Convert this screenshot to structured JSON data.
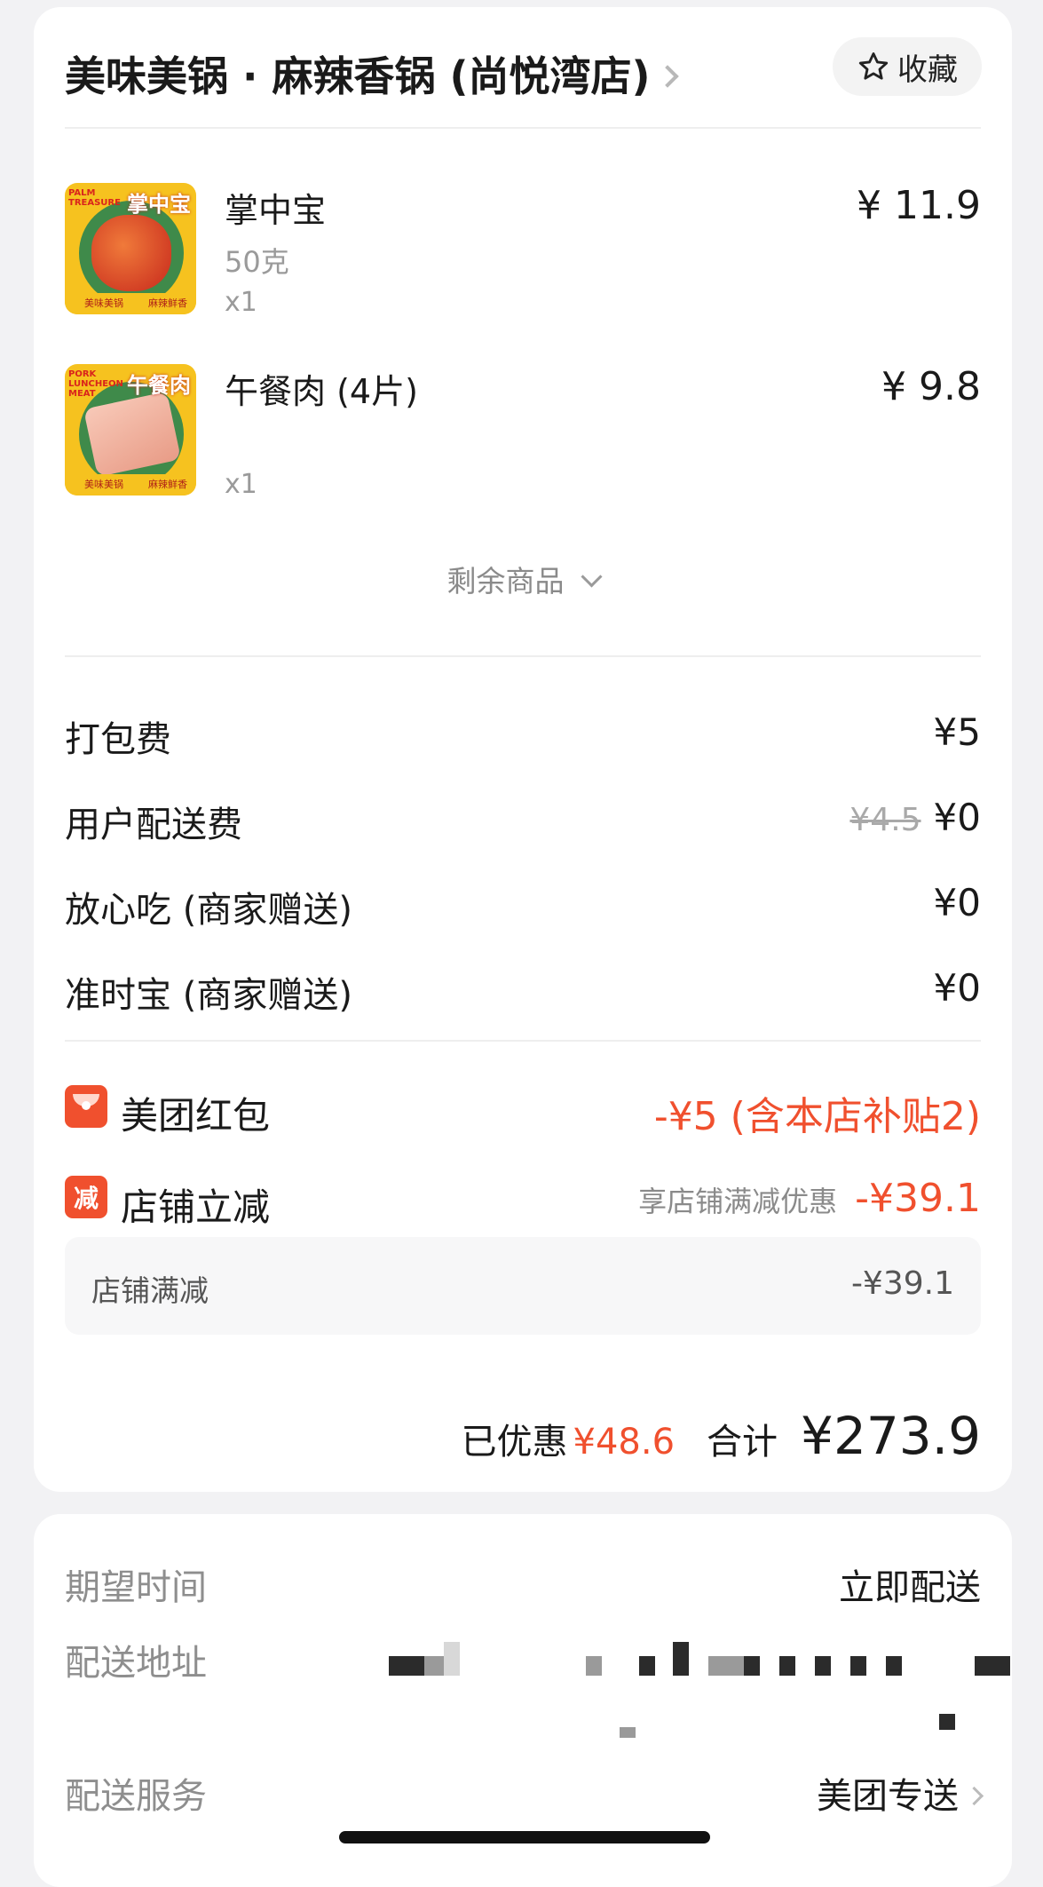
{
  "store": {
    "name": "美味美锅 · 麻辣香锅 (尚悦湾店)",
    "favorite_label": "收藏"
  },
  "items": [
    {
      "name": "掌中宝",
      "spec": "50克",
      "qty": "x1",
      "price": "¥ 11.9",
      "thumb_tag": "掌中宝",
      "thumb_tag_en": "PALM TREASURE",
      "thumb_brand": "美味美锅",
      "thumb_slogan": "麻辣鲜香"
    },
    {
      "name": "午餐肉 (4片)",
      "spec": "",
      "qty": "x1",
      "price": "¥ 9.8",
      "thumb_tag": "午餐肉",
      "thumb_tag_en": "PORK LUNCHEON MEAT",
      "thumb_brand": "美味美锅",
      "thumb_slogan": "麻辣鲜香"
    }
  ],
  "more_items_label": "剩余商品",
  "fees": [
    {
      "label": "打包费",
      "original": "",
      "value": "¥5"
    },
    {
      "label": "用户配送费",
      "original": "¥4.5",
      "value": "¥0"
    },
    {
      "label": "放心吃 (商家赠送)",
      "original": "",
      "value": "¥0"
    },
    {
      "label": "准时宝 (商家赠送)",
      "original": "",
      "value": "¥0"
    }
  ],
  "discounts": {
    "red_packet": {
      "label": "美团红包",
      "value": "-¥5 (含本店补贴2)"
    },
    "store_cut": {
      "icon_text": "减",
      "label": "店铺立减",
      "note": "享店铺满减优惠",
      "value": "-¥39.1"
    },
    "detail": {
      "label": "店铺满减",
      "value": "-¥39.1"
    }
  },
  "summary": {
    "saved_label": "已优惠",
    "saved_value": "¥48.6",
    "total_label": "合计",
    "total_value": "¥273.9"
  },
  "delivery": {
    "time_label": "期望时间",
    "time_value": "立即配送",
    "address_label": "配送地址",
    "service_label": "配送服务",
    "service_value": "美团专送"
  },
  "colors": {
    "accent": "#f0502e",
    "background": "#f2f2f4"
  }
}
